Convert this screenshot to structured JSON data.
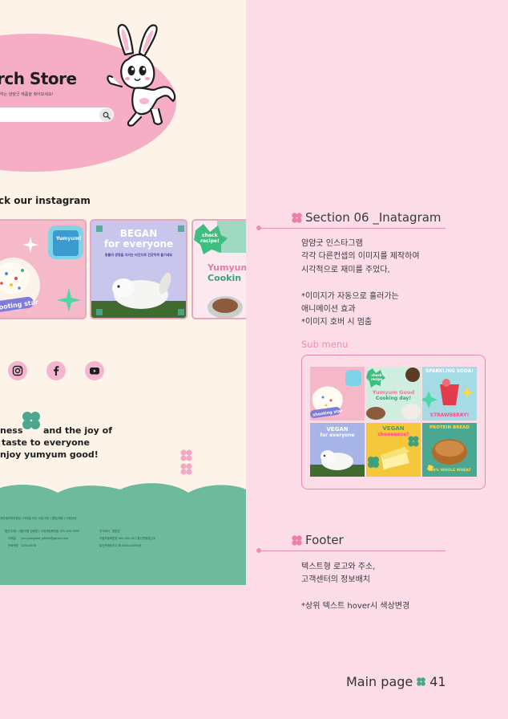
{
  "site": {
    "store_title": "rch Store",
    "store_subtitle": "하는 얌얌굿 제품을 찾아보세요!",
    "instagram_heading": "ck our instagram",
    "cards": {
      "card1_sticker": "Yumyum!",
      "card1_label": "shooting star",
      "card2_title_line1": "BEGAN",
      "card2_title_line2": "for everyone",
      "card2_caption": "동물의 생명을 지키는 비건으로 건강하게 즐기세요",
      "card3_badge_line1": "check",
      "card3_badge_line2": "recipe!",
      "card3_title_line1": "Yumyum",
      "card3_title_line2": "Cookin"
    },
    "tagline": {
      "line1_left": "ness",
      "line1_right": "and the joy of",
      "line2": "taste to everyone",
      "line3": "njoy yumyum good!"
    },
    "footer": {
      "links": "개인정보처리방침  |  이메일 무단 수집 거부  |  협찬/제휴  |  이용안내",
      "row1_left": "법인고/명 : 대표자명 업태명 | 사업자등록번호 123-456-7890",
      "row1_right_label": "주식회사",
      "row1_right_value": "얌얌굿",
      "row2_left_label": "이메일",
      "row2_left_value": "yumyumgood_official@gmail.com",
      "row2_right": "사업자등록번호  000-000-00 | 통신판매업신고",
      "row3_left_label": "전화번호",
      "row3_left_value": "1234-5678",
      "row3_right": "통신판매업신고  제 0000-00000호"
    }
  },
  "sections": [
    {
      "title": "Section 06 _Inatagram",
      "desc": [
        "얌얌굿 인스타그램",
        "각각 다른컨셉의 이미지를 제작하여",
        "시각적으로 재미를 주었다,",
        "",
        "*이미지가 자동으로 흘러가는",
        "애니메이션 효과",
        "*이미지 호버 시 멈춤"
      ]
    },
    {
      "title": "Footer",
      "desc": [
        "텍스트형 로고와 주소,",
        "고객센터의 정보배치",
        "",
        "*상위 텍스트 hover시 색상변경"
      ]
    }
  ],
  "sub_menu": {
    "label": "Sub menu",
    "tiles": {
      "t1": "shooting star",
      "t2_badge": "check recipe",
      "t2_line1": "Yumyum Good",
      "t2_line2": "Cooking day!",
      "t3_top": "SPARKLING SODA!",
      "t3_bottom": "STRAWBERRY!",
      "t4_line1": "VEGAN",
      "t4_line2": "for everyone",
      "t5_line1": "VEGAN",
      "t5_line2": "cheeeeese?",
      "t6_top": "PROTEIN BREAD",
      "t6_bottom": "100% WHOLE WHEAT"
    }
  },
  "page_footer": {
    "label": "Main page",
    "number": "41"
  },
  "colors": {
    "accent_pink": "#f6aec6",
    "line_pink": "#e892b3",
    "clover_green": "#4aa890",
    "footer_green": "#6dba9c",
    "cream": "#fdf3e8",
    "page_bg": "#fcdde7"
  },
  "icons": [
    "search-icon",
    "bunny-mascot",
    "instagram-icon",
    "facebook-icon",
    "youtube-icon",
    "clover-icon"
  ]
}
